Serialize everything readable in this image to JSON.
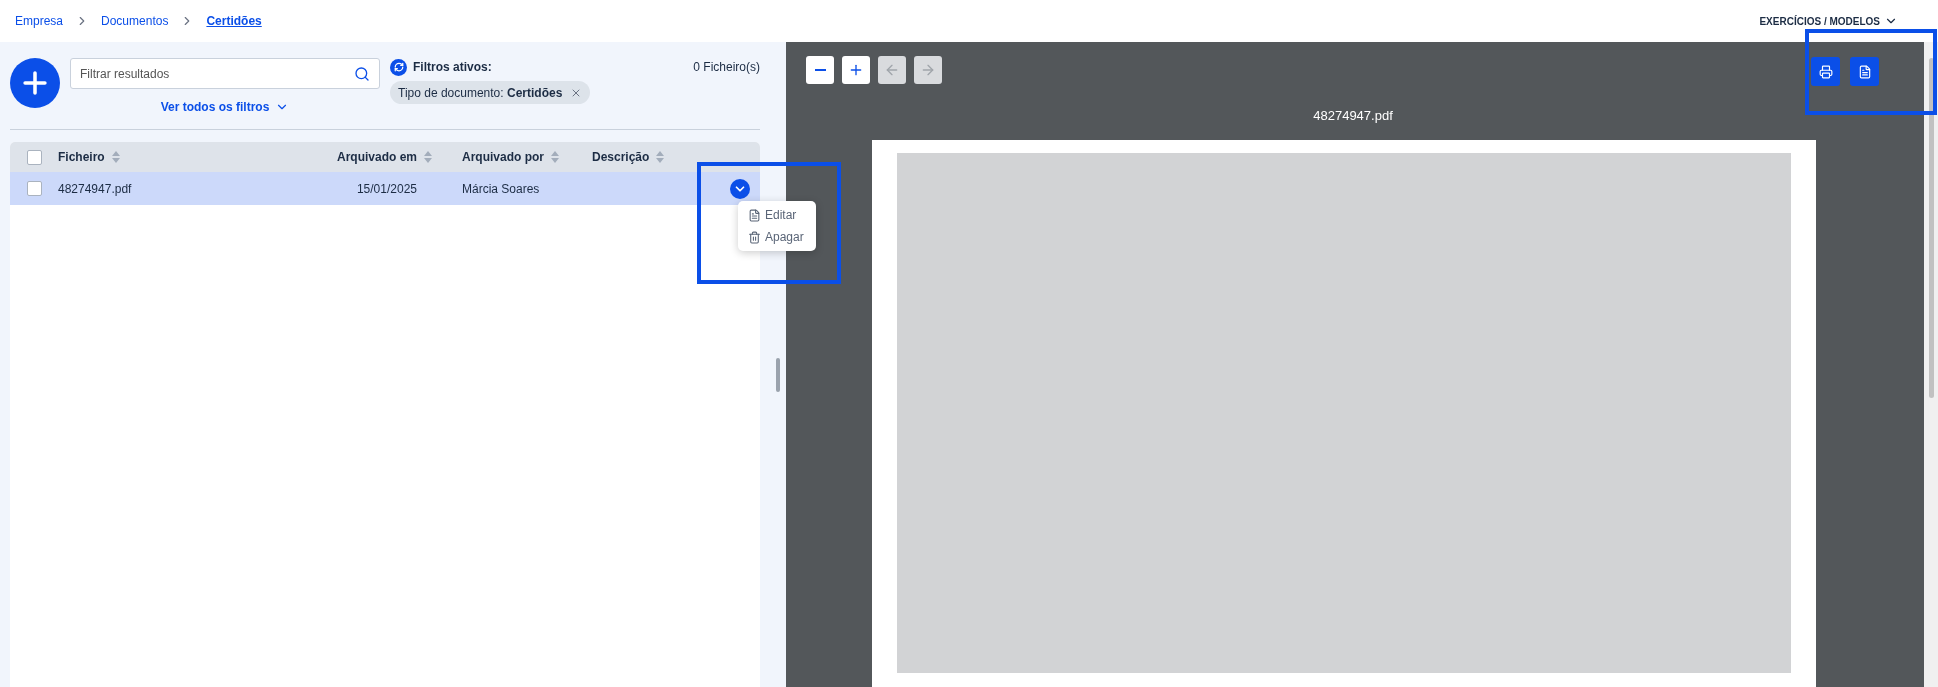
{
  "breadcrumb": [
    {
      "label": "Empresa",
      "current": false
    },
    {
      "label": "Documentos",
      "current": false
    },
    {
      "label": "Certidões",
      "current": true
    }
  ],
  "header_menu": {
    "label": "EXERCÍCIOS / MODELOS"
  },
  "search": {
    "placeholder": "Filtrar resultados"
  },
  "filters_link": "Ver todos os filtros",
  "active_filters": {
    "title": "Filtros ativos:",
    "chips": [
      {
        "name": "Tipo de documento:",
        "value": "Certidões"
      }
    ]
  },
  "file_count": "0 Ficheiro(s)",
  "table": {
    "select_all": {
      "checked": false
    },
    "columns": [
      {
        "label": "Ficheiro"
      },
      {
        "label": "Arquivado em"
      },
      {
        "label": "Arquivado por"
      },
      {
        "label": "Descrição"
      }
    ],
    "rows": [
      {
        "selected": true,
        "checked": false,
        "file": "48274947.pdf",
        "archived_on": "15/01/2025",
        "archived_by": "Márcia Soares"
      }
    ]
  },
  "row_menu": {
    "items": [
      {
        "label": "Editar",
        "kind": "edit"
      },
      {
        "label": "Apagar",
        "kind": "delete"
      }
    ]
  },
  "viewer": {
    "title": "48274947.pdf",
    "nav": [
      {
        "kind": "zoom-out",
        "disabled": false
      },
      {
        "kind": "zoom-in",
        "disabled": false
      },
      {
        "kind": "previous",
        "disabled": true
      },
      {
        "kind": "next",
        "disabled": true
      }
    ],
    "actions": [
      {
        "kind": "print"
      },
      {
        "kind": "pdf"
      }
    ]
  }
}
